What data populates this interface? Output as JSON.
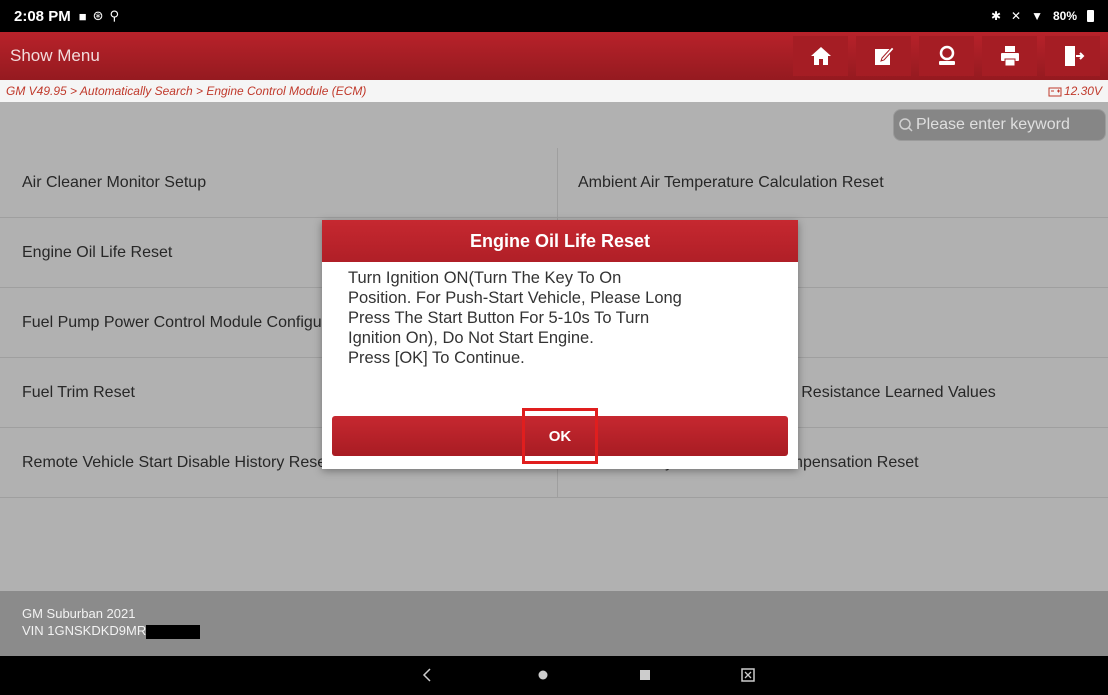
{
  "status": {
    "time": "2:08 PM",
    "battery": "80%"
  },
  "titlebar": {
    "menu_label": "Show Menu"
  },
  "breadcrumb": {
    "path": "GM V49.95 > Automatically Search > Engine Control Module (ECM)",
    "voltage": "12.30V"
  },
  "search": {
    "placeholder": "Please enter keyword"
  },
  "functions": {
    "left": [
      "Air Cleaner Monitor Setup",
      "Engine Oil Life Reset",
      "Fuel Pump Power Control Module Configuration",
      "Fuel Trim Reset",
      "Remote Vehicle Start Disable History Reset"
    ],
    "right": [
      "Ambient Air Temperature Calculation Reset",
      "",
      "",
      "Heated Oxygen Sensor Heater Resistance Learned Values",
      "Throttle Body Idle Air Flow Compensation Reset"
    ]
  },
  "vehicle": {
    "model": "GM Suburban 2021",
    "vin": "VIN 1GNSKDKD9MR"
  },
  "dialog": {
    "title": "Engine Oil Life Reset",
    "lines": [
      "Turn Ignition ON(Turn The Key To On",
      "Position. For Push-Start Vehicle, Please Long",
      "Press The Start Button For 5-10s To Turn",
      "Ignition On), Do Not Start Engine.",
      "Press [OK] To Continue."
    ],
    "ok_label": "OK"
  },
  "colors": {
    "accent": "#b01f27",
    "highlight": "#e01e1e"
  }
}
